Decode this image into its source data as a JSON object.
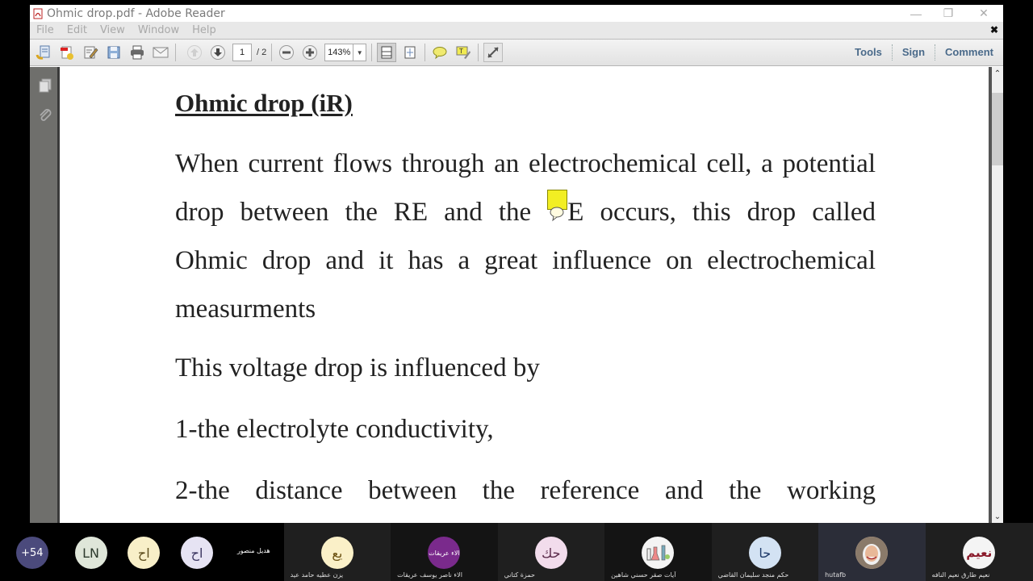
{
  "window": {
    "title": "Ohmic drop.pdf - Adobe Reader",
    "controls": {
      "minimize": "—",
      "restore": "❐",
      "close": "✕"
    }
  },
  "menu": {
    "items": [
      "File",
      "Edit",
      "View",
      "Window",
      "Help"
    ],
    "close_glyph": "✖"
  },
  "toolbar": {
    "page_current": "1",
    "page_total": "/ 2",
    "zoom": "143%",
    "zoom_dropdown_glyph": "▼",
    "right_tabs": [
      "Tools",
      "Sign",
      "Comment"
    ]
  },
  "document": {
    "heading": "Ohmic drop (iR)",
    "para1_lines": [
      "When current flows through an electrochemical cell, a potential",
      [
        "drop between the RE and the ",
        "E occurs, this drop called"
      ],
      "Ohmic drop and it has a great influence on electrochemical",
      "measurments"
    ],
    "para2": "This voltage drop is influenced by",
    "item1": "1-the electrolyte conductivity,",
    "item2": "2-the distance between the reference and the working"
  },
  "scrollbar": {
    "up": "⌃",
    "down": "⌄",
    "position_fraction": 0.05
  },
  "participants": {
    "overflow": {
      "label": "+54",
      "color": "#4b4a7c",
      "text_color": "#ffffff"
    },
    "small": [
      {
        "initials": "LN",
        "color": "#dfe6d9",
        "text_color": "#2d3a2d"
      },
      {
        "initials": "اح",
        "color": "#f8efc8",
        "text_color": "#5a4a1a"
      },
      {
        "initials": "اح",
        "color": "#e6e3f3",
        "text_color": "#3a3560"
      }
    ],
    "label_only": "هديل منصور",
    "tiles": [
      {
        "initials": "يع",
        "name": "يزن عطيه حامد عيد",
        "color": "#faf0c8",
        "text_color": "#6a5010",
        "style": ""
      },
      {
        "initials": "الاء عريقات",
        "name": "الاء ناصر يوسف عريقات",
        "color": "#7a2a8c",
        "text_color": "#ffffff",
        "style": "dark"
      },
      {
        "initials": "حك",
        "name": "حمزة كتاني",
        "color": "#f2dcec",
        "text_color": "#5a2a4a",
        "style": ""
      },
      {
        "initials": "",
        "name": "آيات صقر حسني شاهين",
        "color": "#f4f4f4",
        "text_color": "#333",
        "style": "dark"
      },
      {
        "initials": "حا",
        "name": "حكم منجد سليمان القاضي",
        "color": "#d3e2f3",
        "text_color": "#1e3a6a",
        "style": ""
      },
      {
        "initials": "",
        "name": "hutafb",
        "color": "#e6c4a8",
        "text_color": "#333",
        "style": "active"
      },
      {
        "initials": "نعيم",
        "name": "نعيم طارق نعيم النافه",
        "color": "#f4f4f4",
        "text_color": "#8a1a2a",
        "style": ""
      }
    ]
  }
}
